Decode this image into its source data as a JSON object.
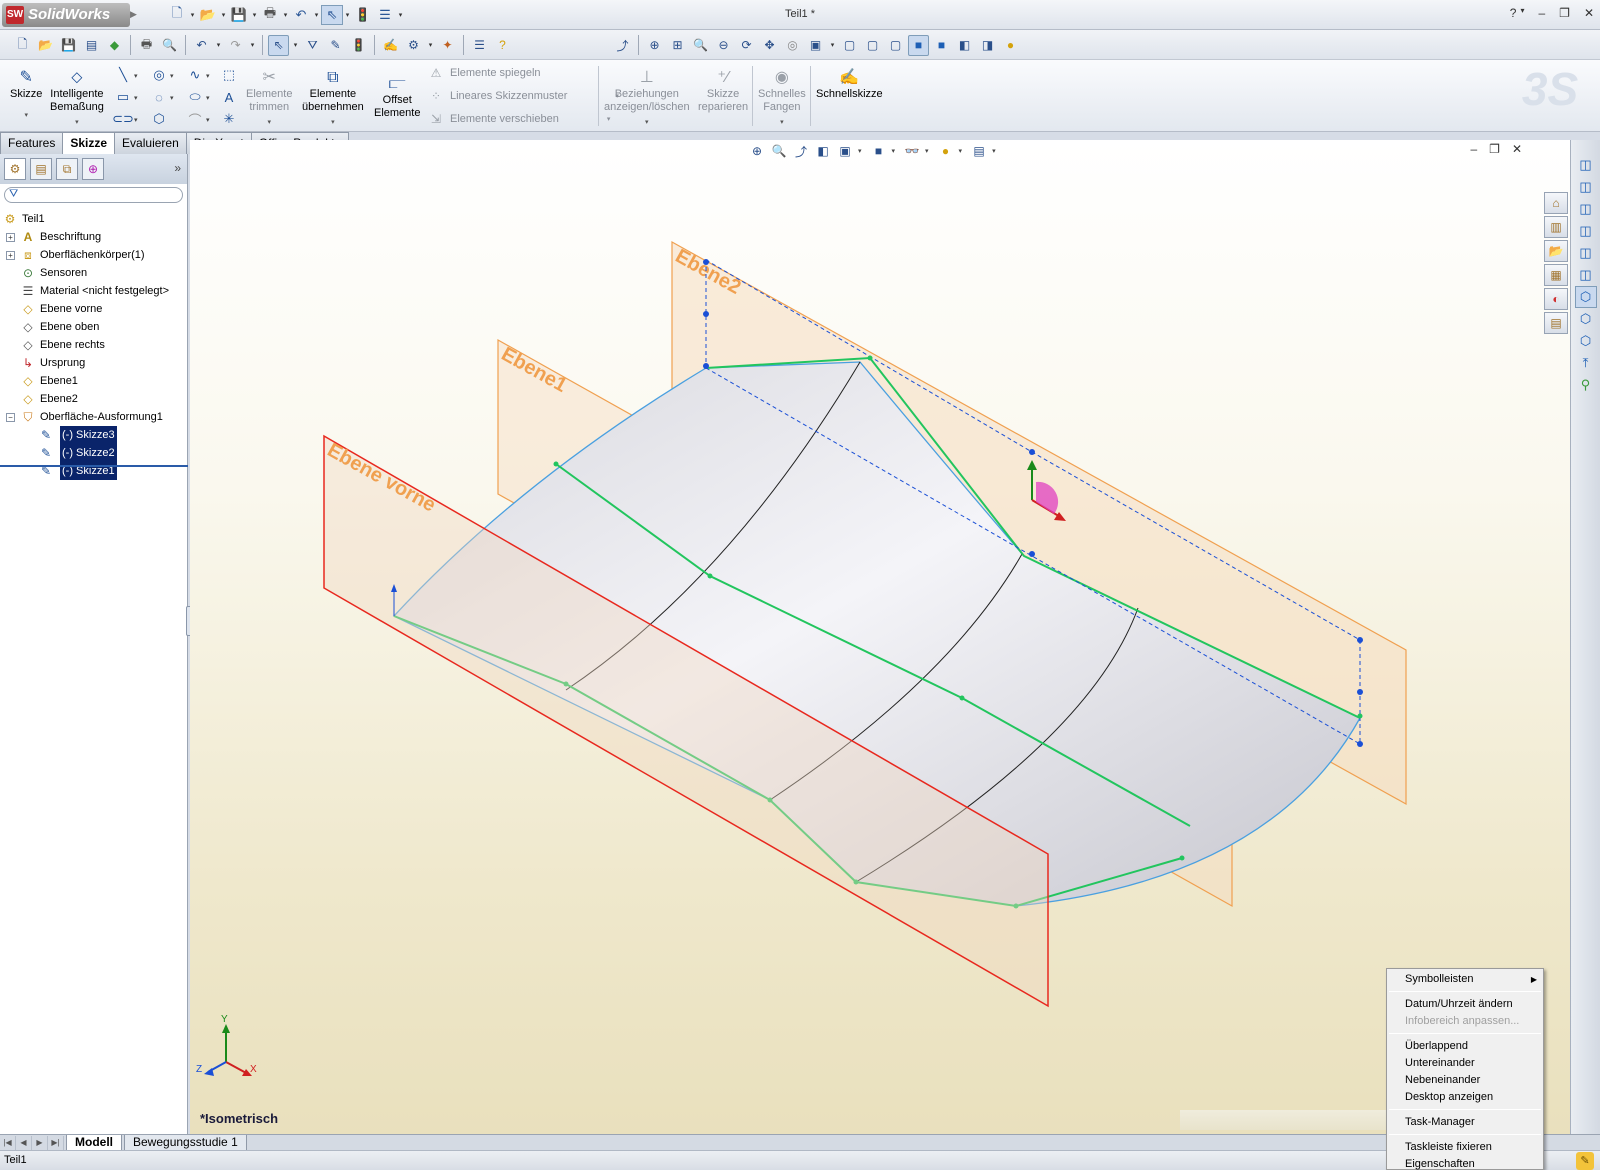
{
  "app": {
    "name": "SolidWorks",
    "logo_mark": "SW",
    "document_title": "Teil1 *",
    "help_label": "?",
    "accent_color": "#c0282d"
  },
  "quick_access": {
    "icons": [
      "new-document-icon",
      "open-icon",
      "save-icon",
      "print-icon",
      "undo-icon",
      "select-icon",
      "rebuild-icon",
      "options-icon"
    ]
  },
  "standard_toolbar": {
    "icons": [
      "new-icon",
      "open-icon",
      "save-icon",
      "print-icon",
      "print-preview-icon",
      "undo-icon",
      "redo-icon",
      "select-icon",
      "select-filter-icon",
      "rebuild-icon",
      "options-icon",
      "help-icon",
      "zoom-to-fit-icon",
      "zoom-area-icon",
      "zoom-in-icon",
      "rotate-icon",
      "pan-icon",
      "view-orientation-icon",
      "display-style-icon"
    ]
  },
  "command_manager": {
    "sketch": {
      "label": "Skizze"
    },
    "smart_dimension": {
      "label_1": "Intelligente",
      "label_2": "Bemaßung"
    },
    "trim": {
      "label_1": "Elemente",
      "label_2": "trimmen"
    },
    "convert": {
      "label_1": "Elemente",
      "label_2": "übernehmen"
    },
    "offset": {
      "label_1": "Offset",
      "label_2": "Elemente"
    },
    "mirror": {
      "label": "Elemente spiegeln"
    },
    "linear_pattern": {
      "label": "Lineares Skizzenmuster"
    },
    "move": {
      "label": "Elemente verschieben"
    },
    "relations": {
      "label_1": "Beziehungen",
      "label_2": "anzeigen/löschen"
    },
    "repair": {
      "label_1": "Skizze",
      "label_2": "reparieren"
    },
    "snap": {
      "label_1": "Schnelles",
      "label_2": "Fangen"
    },
    "rapid_sketch": {
      "label": "Schnellskizze"
    },
    "brand_mark": "3S"
  },
  "command_tabs": [
    {
      "label": "Features",
      "active": false
    },
    {
      "label": "Skizze",
      "active": true
    },
    {
      "label": "Evaluieren",
      "active": false
    },
    {
      "label": "DimXpert",
      "active": false
    },
    {
      "label": "Office Produkte",
      "active": false
    }
  ],
  "feature_tree": {
    "root": "Teil1",
    "items": [
      {
        "label": "Beschriftung",
        "icon": "annotations-icon",
        "expandable": true
      },
      {
        "label": "Oberflächenkörper(1)",
        "icon": "surface-bodies-icon",
        "expandable": true
      },
      {
        "label": "Sensoren",
        "icon": "sensor-icon",
        "expandable": false
      },
      {
        "label": "Material <nicht festgelegt>",
        "icon": "material-icon",
        "expandable": false
      },
      {
        "label": "Ebene vorne",
        "icon": "plane-icon",
        "expandable": false
      },
      {
        "label": "Ebene oben",
        "icon": "plane-icon",
        "expandable": false
      },
      {
        "label": "Ebene rechts",
        "icon": "plane-icon",
        "expandable": false
      },
      {
        "label": "Ursprung",
        "icon": "origin-icon",
        "expandable": false
      },
      {
        "label": "Ebene1",
        "icon": "plane-icon",
        "expandable": false
      },
      {
        "label": "Ebene2",
        "icon": "plane-icon",
        "expandable": false
      },
      {
        "label": "Oberfläche-Ausformung1",
        "icon": "loft-surface-icon",
        "expandable": true
      }
    ],
    "children": [
      {
        "label": "(-) Skizze3",
        "selected": true
      },
      {
        "label": "(-) Skizze2",
        "selected": true
      },
      {
        "label": "(-) Skizze1",
        "selected": true
      }
    ]
  },
  "viewport": {
    "plane_labels": {
      "front": "Ebene vorne",
      "plane1": "Ebene1",
      "plane2": "Ebene2"
    },
    "axis_labels": {
      "x": "X",
      "y": "Y",
      "z": "Z"
    },
    "view_name": "*Isometrisch",
    "colors": {
      "front_plane": "#e8281e",
      "offset_planes": "#f0a050",
      "loft_edges": "#22c55e",
      "sketch_lines": "#1a4fd6",
      "surface_edge": "#4aa0e0"
    }
  },
  "bottom_tabs": [
    {
      "label": "Modell",
      "active": true
    },
    {
      "label": "Bewegungsstudie 1",
      "active": false
    }
  ],
  "status": {
    "text": "Teil1"
  },
  "context_menu": {
    "items": [
      {
        "label": "Symbolleisten",
        "submenu": true,
        "disabled": false
      },
      {
        "separator": true
      },
      {
        "label": "Datum/Uhrzeit ändern",
        "disabled": false
      },
      {
        "label": "Infobereich anpassen...",
        "disabled": true
      },
      {
        "separator": true
      },
      {
        "label": "Überlappend",
        "disabled": false
      },
      {
        "label": "Untereinander",
        "disabled": false
      },
      {
        "label": "Nebeneinander",
        "disabled": false
      },
      {
        "label": "Desktop anzeigen",
        "disabled": false
      },
      {
        "separator": true
      },
      {
        "label": "Task-Manager",
        "disabled": false
      },
      {
        "separator": true
      },
      {
        "label": "Taskleiste fixieren",
        "disabled": false
      },
      {
        "label": "Eigenschaften",
        "disabled": false
      }
    ]
  }
}
